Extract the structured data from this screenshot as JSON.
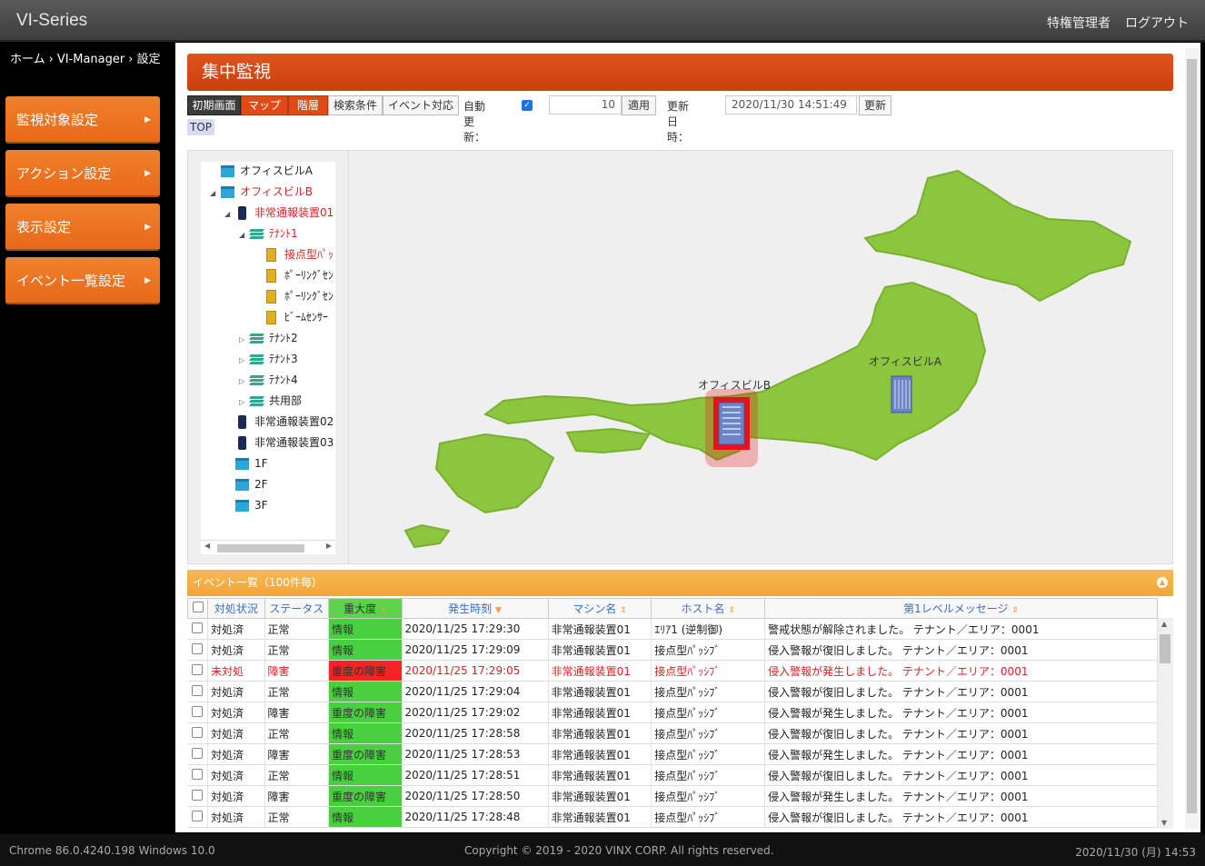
{
  "app": {
    "title": "VI-Series",
    "user": "特権管理者",
    "logout": "ログアウト"
  },
  "breadcrumb": [
    "ホーム",
    "›",
    "VI-Manager",
    "›",
    "設定"
  ],
  "sidebar": {
    "items": [
      {
        "label": "監視対象設定"
      },
      {
        "label": "アクション設定"
      },
      {
        "label": "表示設定"
      },
      {
        "label": "イベント一覧設定"
      }
    ]
  },
  "page": {
    "title": "集中監視"
  },
  "toolbar": {
    "tabs": [
      "初期画面",
      "マップ",
      "階層",
      "検索条件",
      "イベント対応"
    ],
    "auto_refresh_label": "自動更新：",
    "auto_refresh_checked": true,
    "interval_value": "10",
    "apply_label": "適用",
    "updated_label": "更新日時：",
    "updated_value": "2020/11/30 14:51:49",
    "refresh_label": "更新",
    "top_label": "TOP"
  },
  "tree": [
    {
      "label": "オフィスビルA",
      "icon": "building-icon",
      "level": 0,
      "toggle": "",
      "alert": false
    },
    {
      "label": "オフィスビルB",
      "icon": "building-icon",
      "level": 0,
      "toggle": "◢",
      "alert": true
    },
    {
      "label": "非常通報装置01",
      "icon": "device-icon",
      "level": 1,
      "toggle": "◢",
      "alert": true
    },
    {
      "label": "ﾃﾅﾝﾄ1",
      "icon": "layers-icon",
      "level": 2,
      "toggle": "◢",
      "alert": true
    },
    {
      "label": "接点型ﾊﾟｯ",
      "icon": "sensor-icon",
      "level": 3,
      "toggle": "",
      "alert": true
    },
    {
      "label": "ﾎﾟｰﾘﾝｸﾞｾﾝ",
      "icon": "sensor-icon",
      "level": 3,
      "toggle": "",
      "alert": false
    },
    {
      "label": "ﾎﾟｰﾘﾝｸﾞｾﾝ",
      "icon": "sensor-icon",
      "level": 3,
      "toggle": "",
      "alert": false
    },
    {
      "label": "ﾋﾞｰﾑｾﾝｻｰ",
      "icon": "sensor-icon",
      "level": 3,
      "toggle": "",
      "alert": false
    },
    {
      "label": "ﾃﾅﾝﾄ2",
      "icon": "layers-icon",
      "level": 2,
      "toggle": "▷",
      "alert": false
    },
    {
      "label": "ﾃﾅﾝﾄ3",
      "icon": "layers-icon",
      "level": 2,
      "toggle": "▷",
      "alert": false
    },
    {
      "label": "ﾃﾅﾝﾄ4",
      "icon": "layers-icon",
      "level": 2,
      "toggle": "▷",
      "alert": false
    },
    {
      "label": "共用部",
      "icon": "layers-icon",
      "level": 2,
      "toggle": "▷",
      "alert": false
    },
    {
      "label": "非常通報装置02",
      "icon": "device-icon",
      "level": 1,
      "toggle": "",
      "alert": false
    },
    {
      "label": "非常通報装置03",
      "icon": "device-icon",
      "level": 1,
      "toggle": "",
      "alert": false
    },
    {
      "label": "1F",
      "icon": "building-icon",
      "level": 1,
      "toggle": "",
      "alert": false
    },
    {
      "label": "2F",
      "icon": "building-icon",
      "level": 1,
      "toggle": "",
      "alert": false
    },
    {
      "label": "3F",
      "icon": "building-icon",
      "level": 1,
      "toggle": "",
      "alert": false
    }
  ],
  "map": {
    "label_a": "オフィスビルA",
    "label_b": "オフィスビルB",
    "alert_color": "#e8101a",
    "land_color": "#8cc63f"
  },
  "events": {
    "header": "イベント一覧（100件毎）",
    "columns": [
      "対処状況",
      "ステータス",
      "重大度",
      "発生時刻",
      "マシン名",
      "ホスト名",
      "第1レベルメッセージ"
    ],
    "rows": [
      {
        "handle": "対処済",
        "status": "正常",
        "severity": "情報",
        "time": "2020/11/25 17:29:30",
        "machine": "非常通報装置01",
        "host": "ｴﾘｱ1 (逆制御)",
        "message": "警戒状態が解除されました。 テナント／エリア：0001",
        "alert": false,
        "sev_red": false
      },
      {
        "handle": "対処済",
        "status": "正常",
        "severity": "情報",
        "time": "2020/11/25 17:29:09",
        "machine": "非常通報装置01",
        "host": "接点型ﾊﾟｯｼﾌﾞ",
        "message": "侵入警報が復旧しました。 テナント／エリア：0001",
        "alert": false,
        "sev_red": false
      },
      {
        "handle": "未対処",
        "status": "障害",
        "severity": "重度の障害",
        "time": "2020/11/25 17:29:05",
        "machine": "非常通報装置01",
        "host": "接点型ﾊﾟｯｼﾌﾞ",
        "message": "侵入警報が発生しました。 テナント／エリア：0001",
        "alert": true,
        "sev_red": true
      },
      {
        "handle": "対処済",
        "status": "正常",
        "severity": "情報",
        "time": "2020/11/25 17:29:04",
        "machine": "非常通報装置01",
        "host": "接点型ﾊﾟｯｼﾌﾞ",
        "message": "侵入警報が復旧しました。 テナント／エリア：0001",
        "alert": false,
        "sev_red": false
      },
      {
        "handle": "対処済",
        "status": "障害",
        "severity": "重度の障害",
        "time": "2020/11/25 17:29:02",
        "machine": "非常通報装置01",
        "host": "接点型ﾊﾟｯｼﾌﾞ",
        "message": "侵入警報が発生しました。 テナント／エリア：0001",
        "alert": false,
        "sev_red": false
      },
      {
        "handle": "対処済",
        "status": "正常",
        "severity": "情報",
        "time": "2020/11/25 17:28:58",
        "machine": "非常通報装置01",
        "host": "接点型ﾊﾟｯｼﾌﾞ",
        "message": "侵入警報が復旧しました。 テナント／エリア：0001",
        "alert": false,
        "sev_red": false
      },
      {
        "handle": "対処済",
        "status": "障害",
        "severity": "重度の障害",
        "time": "2020/11/25 17:28:53",
        "machine": "非常通報装置01",
        "host": "接点型ﾊﾟｯｼﾌﾞ",
        "message": "侵入警報が発生しました。 テナント／エリア：0001",
        "alert": false,
        "sev_red": false
      },
      {
        "handle": "対処済",
        "status": "正常",
        "severity": "情報",
        "time": "2020/11/25 17:28:51",
        "machine": "非常通報装置01",
        "host": "接点型ﾊﾟｯｼﾌﾞ",
        "message": "侵入警報が復旧しました。 テナント／エリア：0001",
        "alert": false,
        "sev_red": false
      },
      {
        "handle": "対処済",
        "status": "障害",
        "severity": "重度の障害",
        "time": "2020/11/25 17:28:50",
        "machine": "非常通報装置01",
        "host": "接点型ﾊﾟｯｼﾌﾞ",
        "message": "侵入警報が発生しました。 テナント／エリア：0001",
        "alert": false,
        "sev_red": false
      },
      {
        "handle": "対処済",
        "status": "正常",
        "severity": "情報",
        "time": "2020/11/25 17:28:48",
        "machine": "非常通報装置01",
        "host": "接点型ﾊﾟｯｼﾌﾞ",
        "message": "侵入警報が復旧しました。 テナント／エリア：0001",
        "alert": false,
        "sev_red": false
      }
    ]
  },
  "footer": {
    "browser": "Chrome 86.0.4240.198 Windows 10.0",
    "copyright": "Copyright © 2019 - 2020 VINX CORP. All rights reserved.",
    "datetime": "2020/11/30 (月) 14:53"
  }
}
